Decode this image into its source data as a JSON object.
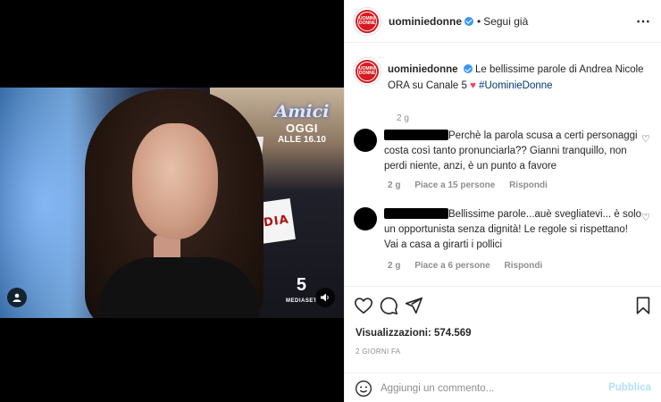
{
  "video": {
    "overlay_logo": "Amici",
    "overlay_line1": "OGGI",
    "overlay_line2": "ALLE 16.10",
    "badge_text": "NADIA",
    "channel_number": "5",
    "channel_label": "MEDIASET"
  },
  "post_header": {
    "username": "uominiedonne",
    "separator": "•",
    "follow_label": "Segui già",
    "more_label": "⋯",
    "avatar_text_1": "UOMINI",
    "avatar_text_2": "DONNE"
  },
  "caption": {
    "username": "uominiedonne",
    "text": "Le bellissime parole di Andrea Nicole ORA su Canale 5",
    "heart": "♥",
    "hashtag": "#UominieDonne",
    "time": "2 g"
  },
  "comments": [
    {
      "text": "Perchè la parola scusa a certi personaggi costa così tanto pronunciarla?? Gianni tranquillo, non perdi niente, anzi, è un punto a favore",
      "time": "2 g",
      "likes": "Piace a 15 persone",
      "reply": "Rispondi"
    },
    {
      "text": "Bellissime parole...auè svegliatevi... è solo un opportunista senza dignità! Le regole si rispettano! Vai a casa a girarti i pollici",
      "time": "2 g",
      "likes": "Piace a 6 persone",
      "reply": "Rispondi"
    }
  ],
  "stats": {
    "views": "Visualizzazioni: 574.569",
    "posted": "2 GIORNI FA"
  },
  "comment_box": {
    "placeholder": "Aggiungi un commento...",
    "publish_label": "Pubblica"
  },
  "colors": {
    "brand_red": "#d71920",
    "link_blue": "#00376b",
    "publish_disabled": "#b2dffc",
    "verified": "#3897f0"
  },
  "icons": [
    "heart-icon",
    "comment-icon",
    "share-icon",
    "bookmark-icon",
    "emoji-icon",
    "user-tag-icon",
    "sound-icon",
    "more-icon",
    "verified-icon"
  ]
}
